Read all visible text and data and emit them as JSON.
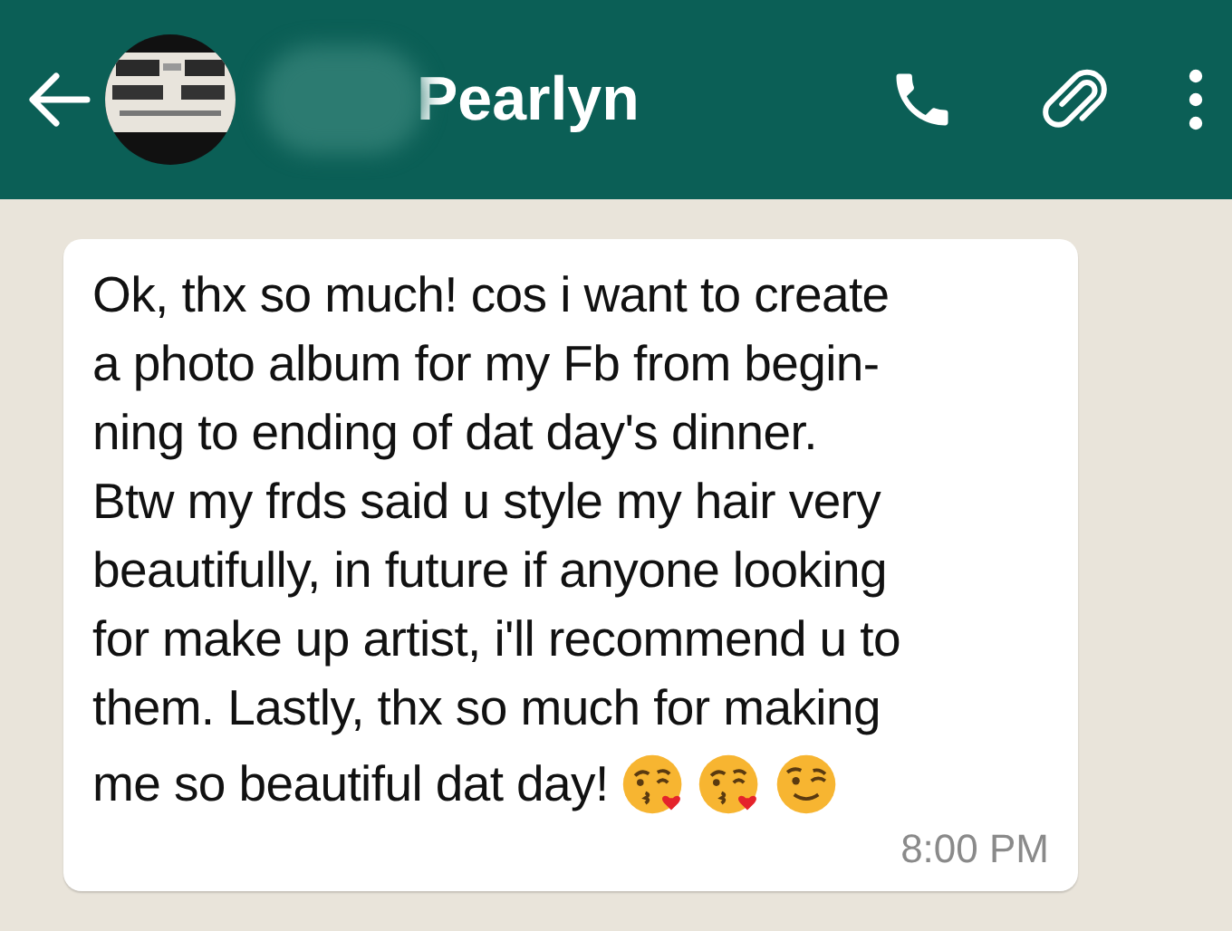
{
  "header": {
    "contact_name": "Pearlyn"
  },
  "message": {
    "text": "Ok, thx so much! cos i want to create\na photo album for my Fb from begin-\nning to ending of dat day's dinner.\nBtw my frds said u style my hair very\nbeautifully, in future if anyone looking\nfor make up artist, i'll recommend u to\nthem. Lastly, thx so much for making\nme so beautiful dat day!",
    "emojis": [
      {
        "kind": "kiss"
      },
      {
        "kind": "kiss"
      },
      {
        "kind": "wink"
      }
    ],
    "time": "8:00 PM"
  }
}
